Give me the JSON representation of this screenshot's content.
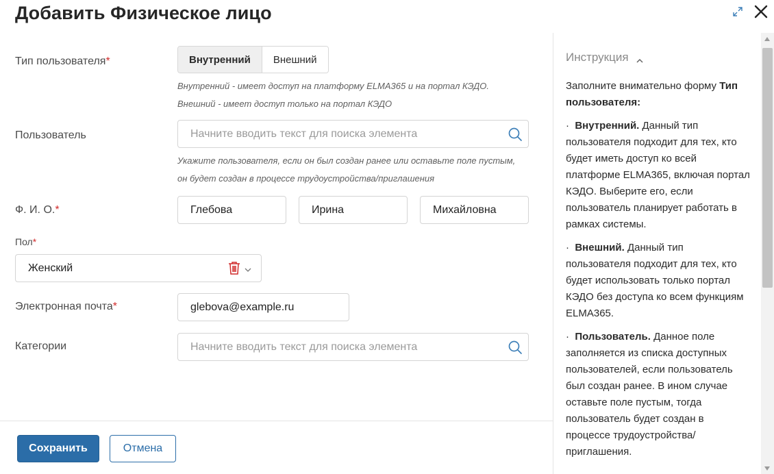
{
  "dialog": {
    "title": "Добавить Физическое лицо"
  },
  "form": {
    "user_type": {
      "label": "Тип пользователя",
      "required_mark": "*",
      "options": [
        "Внутренний",
        "Внешний"
      ],
      "selected": "Внутренний",
      "hint_line1": "Внутренний - имеет доступ на платформу ELMA365 и на портал КЭДО.",
      "hint_line2": "Внешний - имеет доступ только на портал КЭДО"
    },
    "user": {
      "label": "Пользователь",
      "placeholder": "Начните вводить текст для поиска элемента",
      "hint_line1": "Укажите пользователя, если он был создан ранее или оставьте поле пустым,",
      "hint_line2": "он будет создан в процессе трудоустройства/приглашения"
    },
    "full_name": {
      "label": "Ф. И. О.",
      "required_mark": "*",
      "last_name": "Глебова",
      "first_name": "Ирина",
      "middle_name": "Михайловна"
    },
    "gender": {
      "label": "Пол",
      "required_mark": "*",
      "value": "Женский"
    },
    "email": {
      "label": "Электронная почта",
      "required_mark": "*",
      "value": "glebova@example.ru"
    },
    "categories": {
      "label": "Категории",
      "placeholder": "Начните вводить текст для поиска элемента"
    }
  },
  "footer": {
    "save_label": "Сохранить",
    "cancel_label": "Отмена"
  },
  "instruction": {
    "heading": "Инструкция",
    "intro_text": "Заполните внимательно форму ",
    "intro_bold": "Тип пользователя:",
    "items": [
      {
        "bullet": "·",
        "term": "Внутренний.",
        "text": "Данный тип пользователя подходит для тех, кто будет иметь доступ ко всей платформе ELMA365, включая портал КЭДО. Выберите его, если пользователь планирует работать в рамках системы."
      },
      {
        "bullet": "·",
        "term": "Внешний.",
        "text": "Данный тип пользователя подходит для тех, кто будет использовать только портал КЭДО без доступа ко всем функциям ELMA365."
      },
      {
        "bullet": "·",
        "term": "Пользователь.",
        "text": "Данное поле заполняется из списка доступных пользователей, если пользователь был создан ранее. В ином случае оставьте поле пустым, тогда пользователь будет создан в процессе трудоустройства/приглашения."
      }
    ]
  },
  "colors": {
    "primary": "#2b6da8",
    "required": "#d12b2b",
    "icon_blue": "#3d7fb8"
  },
  "icons": {
    "expand": "expand-icon",
    "close": "close-icon",
    "search": "search-icon",
    "delete": "trash-icon",
    "dropdown": "chevron-down-icon",
    "collapse": "chevron-up-icon"
  }
}
